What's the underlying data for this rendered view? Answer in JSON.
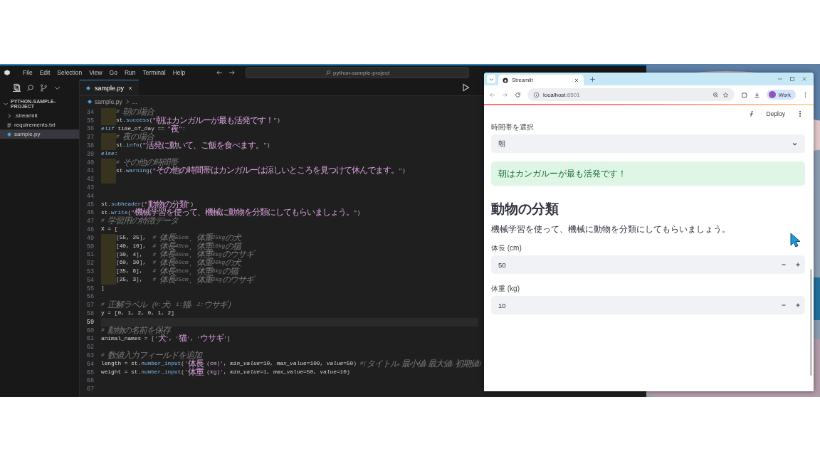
{
  "vscode": {
    "menu": [
      "File",
      "Edit",
      "Selection",
      "View",
      "Go",
      "Run",
      "Terminal",
      "Help"
    ],
    "command_center": "python-sample-project",
    "explorer": {
      "title": "PYTHON-SAMPLE-PROJECT",
      "expanded": true,
      "items": [
        {
          "name": ".streamlit",
          "kind": "folder",
          "selected": false
        },
        {
          "name": "requirements.txt",
          "kind": "text",
          "selected": false
        },
        {
          "name": "sample.py",
          "kind": "python",
          "selected": true
        }
      ]
    },
    "tabs": [
      {
        "label": "sample.py",
        "selected": true
      }
    ],
    "breadcrumb": [
      "sample.py",
      "..."
    ],
    "lines": [
      {
        "number": "34",
        "indent_guide": true,
        "current": false,
        "tokens": [
          {
            "kind": "comment",
            "text": "# 朝の場合"
          }
        ]
      },
      {
        "number": "35",
        "indent_guide": true,
        "current": false,
        "tokens": [
          {
            "kind": "plain",
            "text": "st."
          },
          {
            "kind": "function",
            "text": "success"
          },
          {
            "kind": "bracket",
            "text": "("
          },
          {
            "kind": "string",
            "text": "\"朝はカンガルーが最も活発です！\""
          },
          {
            "kind": "bracket",
            "text": ")"
          }
        ]
      },
      {
        "number": "36",
        "indent_guide": false,
        "current": false,
        "tokens": [
          {
            "kind": "keyword",
            "text": "elif"
          },
          {
            "kind": "plain",
            "text": " time_of_day == "
          },
          {
            "kind": "string",
            "text": "\"夜\""
          },
          {
            "kind": "plain",
            "text": ":"
          }
        ]
      },
      {
        "number": "37",
        "indent_guide": true,
        "current": false,
        "tokens": [
          {
            "kind": "comment",
            "text": "# 夜の場合"
          }
        ]
      },
      {
        "number": "38",
        "indent_guide": true,
        "current": false,
        "tokens": [
          {
            "kind": "plain",
            "text": "st."
          },
          {
            "kind": "function",
            "text": "info"
          },
          {
            "kind": "bracket",
            "text": "("
          },
          {
            "kind": "string",
            "text": "\"活発に動いて、ご飯を食べます。\""
          },
          {
            "kind": "bracket",
            "text": ")"
          }
        ]
      },
      {
        "number": "39",
        "indent_guide": false,
        "current": false,
        "tokens": [
          {
            "kind": "keyword",
            "text": "else"
          },
          {
            "kind": "plain",
            "text": ":"
          }
        ]
      },
      {
        "number": "40",
        "indent_guide": true,
        "current": false,
        "tokens": [
          {
            "kind": "comment",
            "text": "# その他の時間帯"
          }
        ]
      },
      {
        "number": "41",
        "indent_guide": true,
        "current": false,
        "tokens": [
          {
            "kind": "plain",
            "text": "st."
          },
          {
            "kind": "function",
            "text": "warning"
          },
          {
            "kind": "bracket",
            "text": "("
          },
          {
            "kind": "string",
            "text": "\"その他の時間帯はカンガルーは涼しいところを見つけて休んでます。\""
          },
          {
            "kind": "bracket",
            "text": ")"
          }
        ]
      },
      {
        "number": "42",
        "indent_guide": true,
        "current": false
      },
      {
        "number": "43",
        "indent_guide": false,
        "current": false
      },
      {
        "number": "44",
        "indent_guide": false,
        "current": false
      },
      {
        "number": "45",
        "indent_guide": false,
        "current": false,
        "tokens": [
          {
            "kind": "plain",
            "text": "st."
          },
          {
            "kind": "function",
            "text": "subheader"
          },
          {
            "kind": "bracket",
            "text": "("
          },
          {
            "kind": "string",
            "text": "\"動物の分類\""
          },
          {
            "kind": "bracket",
            "text": ")"
          }
        ]
      },
      {
        "number": "46",
        "indent_guide": false,
        "current": false,
        "tokens": [
          {
            "kind": "plain",
            "text": "st."
          },
          {
            "kind": "function",
            "text": "write"
          },
          {
            "kind": "bracket",
            "text": "("
          },
          {
            "kind": "string",
            "text": "\"機械学習を使って、機械に動物を分類にしてもらいましょう。\""
          },
          {
            "kind": "bracket",
            "text": ")"
          }
        ]
      },
      {
        "number": "47",
        "indent_guide": false,
        "current": false,
        "tokens": [
          {
            "kind": "comment",
            "text": "# 学習用の特徴データ"
          }
        ]
      },
      {
        "number": "48",
        "indent_guide": false,
        "current": false,
        "tokens": [
          {
            "kind": "plain",
            "text": "X = "
          },
          {
            "kind": "bracket",
            "text": "["
          }
        ]
      },
      {
        "number": "49",
        "indent_guide": true,
        "current": false,
        "tokens": [
          {
            "kind": "bracket",
            "text": "["
          },
          {
            "kind": "plain",
            "text": "55, 25"
          },
          {
            "kind": "bracket",
            "text": "]"
          },
          {
            "kind": "plain",
            "text": ",  "
          },
          {
            "kind": "comment",
            "text": "# 体長55cm、体重25kgの犬"
          }
        ]
      },
      {
        "number": "50",
        "indent_guide": true,
        "current": false,
        "tokens": [
          {
            "kind": "bracket",
            "text": "["
          },
          {
            "kind": "plain",
            "text": "40, 10"
          },
          {
            "kind": "bracket",
            "text": "]"
          },
          {
            "kind": "plain",
            "text": ",  "
          },
          {
            "kind": "comment",
            "text": "# 体長40cm、体重10kgの猫"
          }
        ]
      },
      {
        "number": "51",
        "indent_guide": true,
        "current": false,
        "tokens": [
          {
            "kind": "bracket",
            "text": "["
          },
          {
            "kind": "plain",
            "text": "30, 4"
          },
          {
            "kind": "bracket",
            "text": "]"
          },
          {
            "kind": "plain",
            "text": ",   "
          },
          {
            "kind": "comment",
            "text": "# 体長30cm、体重4kgのウサギ"
          }
        ]
      },
      {
        "number": "52",
        "indent_guide": true,
        "current": false,
        "tokens": [
          {
            "kind": "bracket",
            "text": "["
          },
          {
            "kind": "plain",
            "text": "60, 30"
          },
          {
            "kind": "bracket",
            "text": "]"
          },
          {
            "kind": "plain",
            "text": ",  "
          },
          {
            "kind": "comment",
            "text": "# 体長60cm、体重30kgの犬"
          }
        ]
      },
      {
        "number": "53",
        "indent_guide": true,
        "current": false,
        "tokens": [
          {
            "kind": "bracket",
            "text": "["
          },
          {
            "kind": "plain",
            "text": "35, 8"
          },
          {
            "kind": "bracket",
            "text": "]"
          },
          {
            "kind": "plain",
            "text": ",   "
          },
          {
            "kind": "comment",
            "text": "# 体長35cm、体重8kgの猫"
          }
        ]
      },
      {
        "number": "54",
        "indent_guide": true,
        "current": false,
        "tokens": [
          {
            "kind": "bracket",
            "text": "["
          },
          {
            "kind": "plain",
            "text": "25, 3"
          },
          {
            "kind": "bracket",
            "text": "]"
          },
          {
            "kind": "plain",
            "text": ",   "
          },
          {
            "kind": "comment",
            "text": "# 体長25cm、体重3kgのウサギ"
          }
        ]
      },
      {
        "number": "55",
        "indent_guide": false,
        "current": false,
        "tokens": [
          {
            "kind": "bracket",
            "text": "]"
          }
        ]
      },
      {
        "number": "56",
        "indent_guide": false,
        "current": false
      },
      {
        "number": "57",
        "indent_guide": false,
        "current": false,
        "tokens": [
          {
            "kind": "comment",
            "text": "# 正解ラベル（0:犬, 1:猫, 2:ウサギ）"
          }
        ]
      },
      {
        "number": "58",
        "indent_guide": false,
        "current": false,
        "tokens": [
          {
            "kind": "plain",
            "text": "y = "
          },
          {
            "kind": "bracket",
            "text": "["
          },
          {
            "kind": "plain",
            "text": "0, 1, 2, 0, 1, 2"
          },
          {
            "kind": "bracket",
            "text": "]"
          }
        ]
      },
      {
        "number": "59",
        "indent_guide": false,
        "current": true
      },
      {
        "number": "60",
        "indent_guide": false,
        "current": false,
        "tokens": [
          {
            "kind": "comment",
            "text": "# 動物の名前を保存"
          }
        ]
      },
      {
        "number": "61",
        "indent_guide": false,
        "current": false,
        "tokens": [
          {
            "kind": "plain",
            "text": "animal_names = "
          },
          {
            "kind": "bracket",
            "text": "["
          },
          {
            "kind": "string",
            "text": "'犬'"
          },
          {
            "kind": "plain",
            "text": ", "
          },
          {
            "kind": "string",
            "text": "'猫'"
          },
          {
            "kind": "plain",
            "text": ", "
          },
          {
            "kind": "string",
            "text": "'ウサギ'"
          },
          {
            "kind": "bracket",
            "text": "]"
          }
        ]
      },
      {
        "number": "62",
        "indent_guide": false,
        "current": false
      },
      {
        "number": "63",
        "indent_guide": false,
        "current": false,
        "tokens": [
          {
            "kind": "comment",
            "text": "# 数値入力フィールドを追加"
          }
        ]
      },
      {
        "number": "64",
        "indent_guide": false,
        "current": false,
        "tokens": [
          {
            "kind": "plain",
            "text": "length = st."
          },
          {
            "kind": "function",
            "text": "number_input"
          },
          {
            "kind": "bracket",
            "text": "("
          },
          {
            "kind": "string",
            "text": "'体長 (cm)'"
          },
          {
            "kind": "plain",
            "text": ", "
          },
          {
            "kind": "param",
            "text": "min_value"
          },
          {
            "kind": "plain",
            "text": "=10, "
          },
          {
            "kind": "param",
            "text": "max_value"
          },
          {
            "kind": "plain",
            "text": "=100, "
          },
          {
            "kind": "param",
            "text": "value"
          },
          {
            "kind": "plain",
            "text": "=50"
          },
          {
            "kind": "bracket",
            "text": ") "
          },
          {
            "kind": "comment",
            "text": "#(タイトル,最小値,最大値,初期値)"
          }
        ]
      },
      {
        "number": "65",
        "indent_guide": false,
        "current": false,
        "tokens": [
          {
            "kind": "plain",
            "text": "weight = st."
          },
          {
            "kind": "function",
            "text": "number_input"
          },
          {
            "kind": "bracket",
            "text": "("
          },
          {
            "kind": "string",
            "text": "'体重 (kg)'"
          },
          {
            "kind": "plain",
            "text": ", "
          },
          {
            "kind": "param",
            "text": "min_value"
          },
          {
            "kind": "plain",
            "text": "=1, "
          },
          {
            "kind": "param",
            "text": "max_value"
          },
          {
            "kind": "plain",
            "text": "=50, "
          },
          {
            "kind": "param",
            "text": "value"
          },
          {
            "kind": "plain",
            "text": "=10"
          },
          {
            "kind": "bracket",
            "text": ")"
          }
        ]
      },
      {
        "number": "66",
        "indent_guide": false,
        "current": false
      },
      {
        "number": "67",
        "indent_guide": false,
        "current": false
      }
    ]
  },
  "browser": {
    "tabs": [
      {
        "label": "Streamlit",
        "selected": true
      }
    ],
    "address": {
      "host": "localhost",
      "port": ":8501"
    },
    "profile": "Work",
    "deploy": "Deploy",
    "widgets": [
      {
        "kind": "select",
        "label": "時間帯を選択",
        "value": "朝"
      },
      {
        "kind": "success",
        "text": "朝はカンガルーが最も活発です！"
      },
      {
        "kind": "subheader",
        "text": "動物の分類"
      },
      {
        "kind": "text",
        "text": "機械学習を使って、機械に動物を分類にしてもらいましょう。"
      },
      {
        "kind": "number",
        "label": "体長 (cm)",
        "value": "50"
      },
      {
        "kind": "number",
        "label": "体重 (kg)",
        "value": "10"
      }
    ]
  }
}
